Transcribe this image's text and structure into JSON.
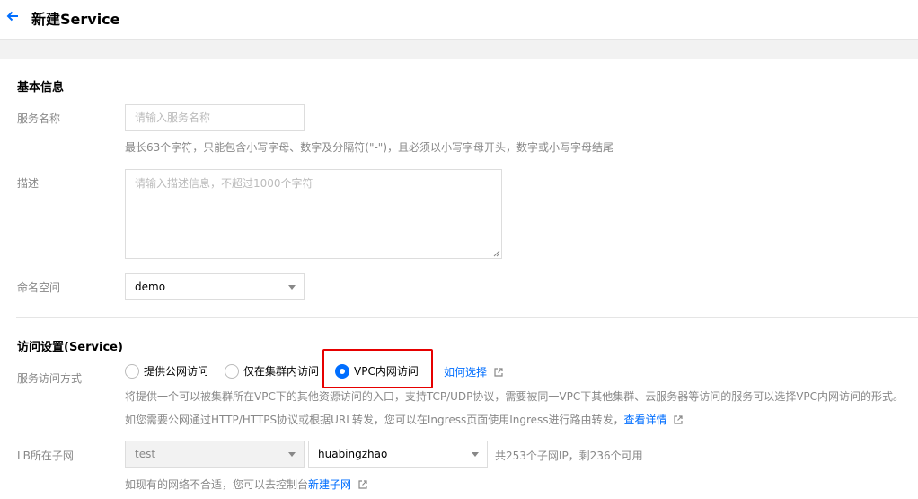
{
  "header": {
    "title": "新建Service"
  },
  "basic": {
    "section_title": "基本信息",
    "service_name": {
      "label": "服务名称",
      "placeholder": "请输入服务名称",
      "hint": "最长63个字符，只能包含小写字母、数字及分隔符(\"-\")，且必须以小写字母开头，数字或小写字母结尾"
    },
    "description": {
      "label": "描述",
      "placeholder": "请输入描述信息，不超过1000个字符"
    },
    "namespace": {
      "label": "命名空间",
      "value": "demo"
    }
  },
  "access": {
    "section_title": "访问设置(Service)",
    "mode_label": "服务访问方式",
    "options": [
      {
        "label": "提供公网访问",
        "checked": false
      },
      {
        "label": "仅在集群内访问",
        "checked": false
      },
      {
        "label": "VPC内网访问",
        "checked": true
      }
    ],
    "how_to_choose": "如何选择",
    "desc1": "将提供一个可以被集群所在VPC下的其他资源访问的入口，支持TCP/UDP协议，需要被同一VPC下其他集群、云服务器等访问的服务可以选择VPC内网访问的形式。",
    "desc2": "如您需要公网通过HTTP/HTTPS协议或根据URL转发，您可以在Ingress页面使用Ingress进行路由转发，",
    "desc2_link": "查看详情",
    "subnet": {
      "label": "LB所在子网",
      "vpc_value": "test",
      "subnet_value": "huabingzhao",
      "info": "共253个子网IP，剩236个可用",
      "hint": "如现有的网络不合适，您可以去控制台",
      "hint_link": "新建子网"
    }
  },
  "colors": {
    "accent": "#006eff",
    "highlight": "#e60000",
    "muted": "#888888"
  }
}
